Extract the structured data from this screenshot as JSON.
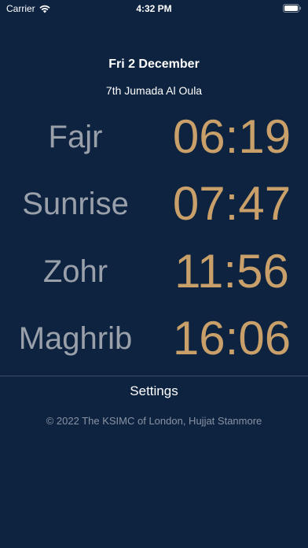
{
  "status_bar": {
    "carrier": "Carrier",
    "time": "4:32 PM"
  },
  "header": {
    "gregorian_date": "Fri 2 December",
    "hijri_date": "7th Jumada Al Oula"
  },
  "prayers": [
    {
      "name": "Fajr",
      "time": "06:19"
    },
    {
      "name": "Sunrise",
      "time": "07:47"
    },
    {
      "name": "Zohr",
      "time": "11:56"
    },
    {
      "name": "Maghrib",
      "time": "16:06"
    }
  ],
  "settings_label": "Settings",
  "footer": {
    "copyright": "© 2022 The KSIMC of London, Hujjat Stanmore"
  },
  "colors": {
    "background": "#0d2340",
    "prayer_name": "#9aa0aa",
    "prayer_time": "#c9a06a"
  },
  "icons": {
    "wifi": "wifi-icon",
    "battery": "battery-icon"
  }
}
